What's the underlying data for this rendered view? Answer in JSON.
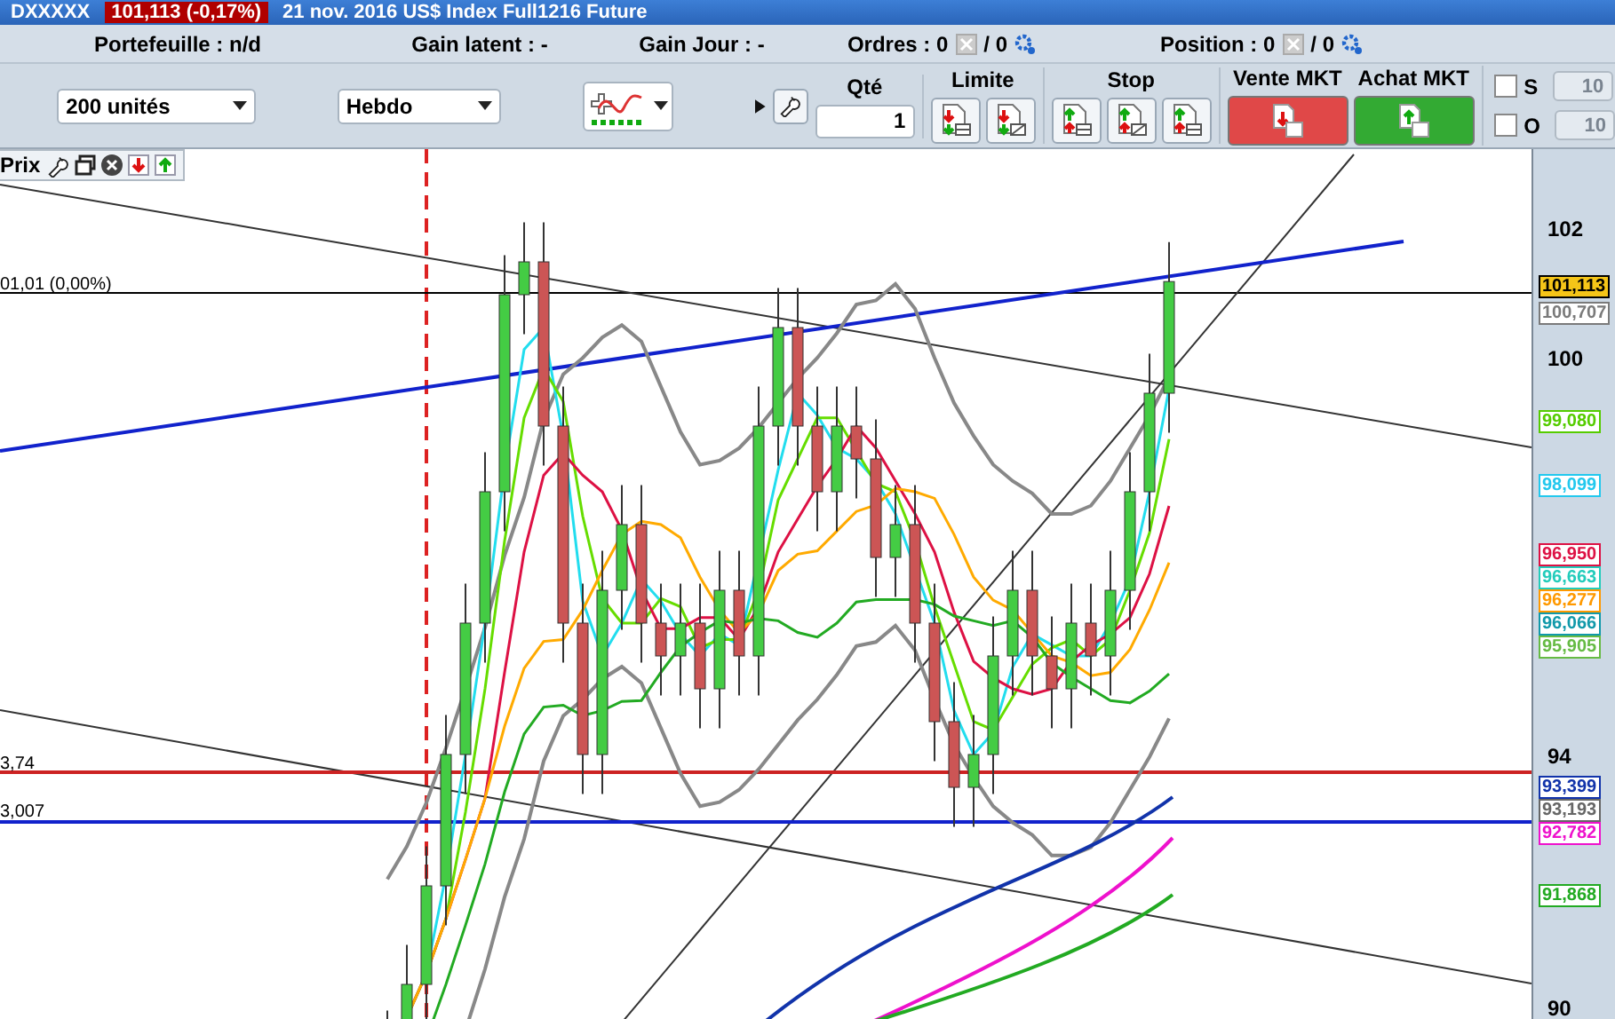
{
  "title_bar": {
    "symbol": "DXXXXX",
    "quote": "101,113 (-0,17%)",
    "description": "21 nov. 2016 US$ Index Full1216 Future"
  },
  "info_bar": {
    "portfolio": "Portefeuille : n/d",
    "latent_gain": "Gain latent : -",
    "day_gain": "Gain Jour : -",
    "orders": {
      "label": "Ordres : 0",
      "total": "/ 0"
    },
    "position": {
      "label": "Position : 0",
      "total": "/ 0"
    }
  },
  "toolbar": {
    "size_select": "200 unités",
    "period_select": "Hebdo",
    "quantity": {
      "label": "Qté",
      "value": "1"
    },
    "limit_label": "Limite",
    "stop_label": "Stop",
    "sell": "Vente MKT",
    "buy": "Achat MKT",
    "toggles": [
      {
        "label": "S",
        "checked": false,
        "value": "10",
        "disabled": true
      },
      {
        "label": "O",
        "checked": false,
        "value": "10",
        "disabled": true
      }
    ]
  },
  "chart": {
    "panel_title": "Prix",
    "line_labels": [
      "01,01 (0,00%)",
      "3,74",
      "3,007"
    ],
    "axis_ticks": [
      "102",
      "100",
      "94",
      "90"
    ],
    "price_tags": [
      {
        "value": "101,113",
        "color": "#000000",
        "highlighted": true
      },
      {
        "value": "100,707",
        "color": "#7a7a7a",
        "highlighted": false
      },
      {
        "value": "99,080",
        "color": "#55cc00",
        "highlighted": false
      },
      {
        "value": "98,099",
        "color": "#22c8ee",
        "highlighted": false
      },
      {
        "value": "96,950",
        "color": "#dd1144",
        "highlighted": false
      },
      {
        "value": "96,663",
        "color": "#22ccbb",
        "highlighted": false
      },
      {
        "value": "96,277",
        "color": "#ff9900",
        "highlighted": false
      },
      {
        "value": "96,066",
        "color": "#1199aa",
        "highlighted": false
      },
      {
        "value": "95,905",
        "color": "#66bb44",
        "highlighted": false
      },
      {
        "value": "93,399",
        "color": "#1133aa",
        "highlighted": false
      },
      {
        "value": "93,193",
        "color": "#666666",
        "highlighted": false
      },
      {
        "value": "92,782",
        "color": "#ee11cc",
        "highlighted": false
      },
      {
        "value": "91,868",
        "color": "#22aa22",
        "highlighted": false
      }
    ]
  }
}
